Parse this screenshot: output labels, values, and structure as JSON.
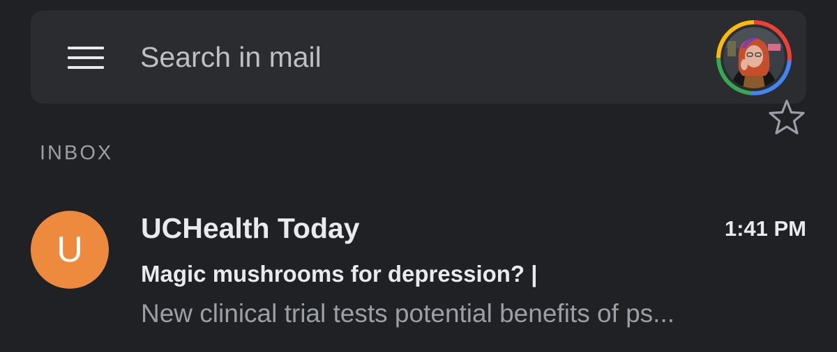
{
  "search": {
    "placeholder": "Search in mail"
  },
  "header": {
    "menu_icon": "menu-icon",
    "account_avatar_icon": "account-avatar-photo",
    "ring_colors": [
      "#ea4335",
      "#4285f4",
      "#34a853",
      "#fbbc05"
    ]
  },
  "section": {
    "label": "INBOX"
  },
  "emails": [
    {
      "avatar_letter": "U",
      "avatar_color": "#ed8a3e",
      "sender": "UCHealth Today",
      "time": "1:41 PM",
      "subject": "Magic mushrooms for depression? |",
      "snippet": "New clinical trial tests potential benefits of ps...",
      "star_icon": "star-outline-icon"
    }
  ]
}
